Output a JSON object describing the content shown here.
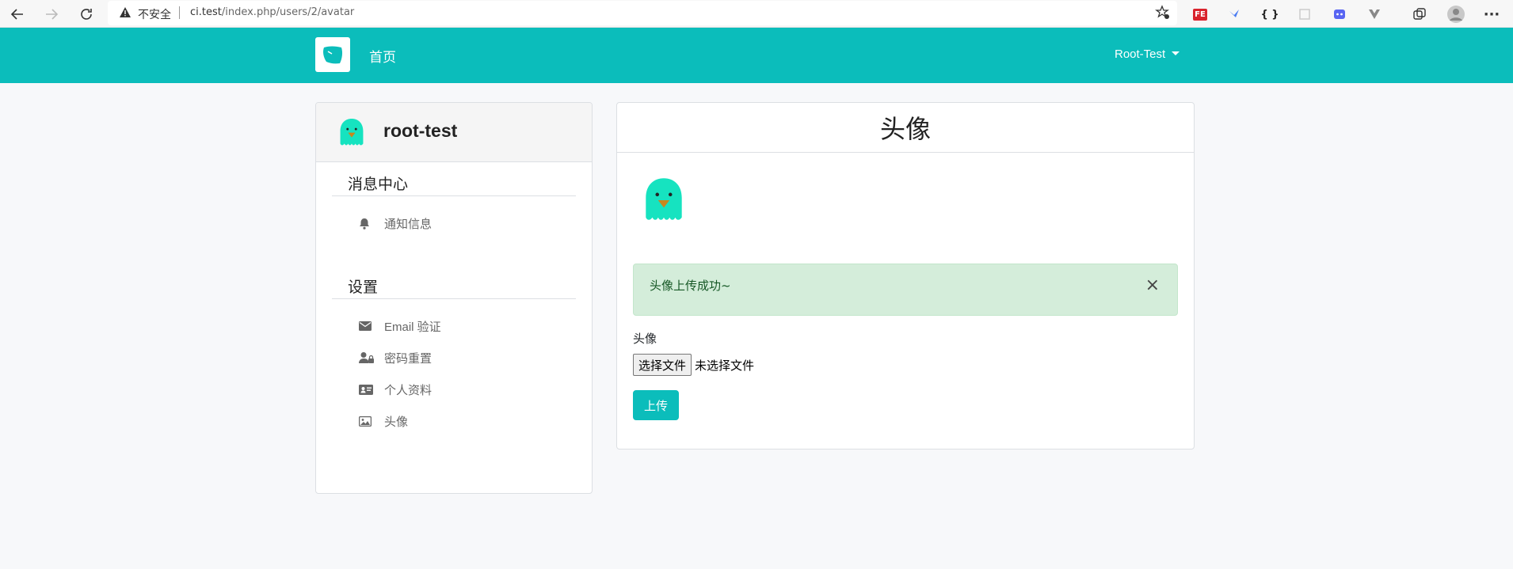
{
  "browser": {
    "security_label": "不安全",
    "url_host": "ci.test",
    "url_path": "/index.php/users/2/avatar"
  },
  "navbar": {
    "home_label": "首页",
    "user_label": "Root-Test"
  },
  "sidebar": {
    "username": "root-test",
    "sections": [
      {
        "title": "消息中心",
        "items": [
          {
            "label": "通知信息",
            "icon": "bell-icon"
          }
        ]
      },
      {
        "title": "设置",
        "items": [
          {
            "label": "Email 验证",
            "icon": "envelope-icon"
          },
          {
            "label": "密码重置",
            "icon": "user-lock-icon"
          },
          {
            "label": "个人资料",
            "icon": "id-card-icon"
          },
          {
            "label": "头像",
            "icon": "image-icon"
          }
        ]
      }
    ]
  },
  "main": {
    "title": "头像",
    "alert_message": "头像上传成功~",
    "alert_close": "×",
    "field_label": "头像",
    "file_button": "选择文件",
    "file_status": "未选择文件",
    "upload_button": "上传"
  },
  "colors": {
    "brand": "#0bbdbb",
    "alert_bg": "#d4edda",
    "alert_text": "#155724",
    "avatar": "#16e3c0"
  }
}
